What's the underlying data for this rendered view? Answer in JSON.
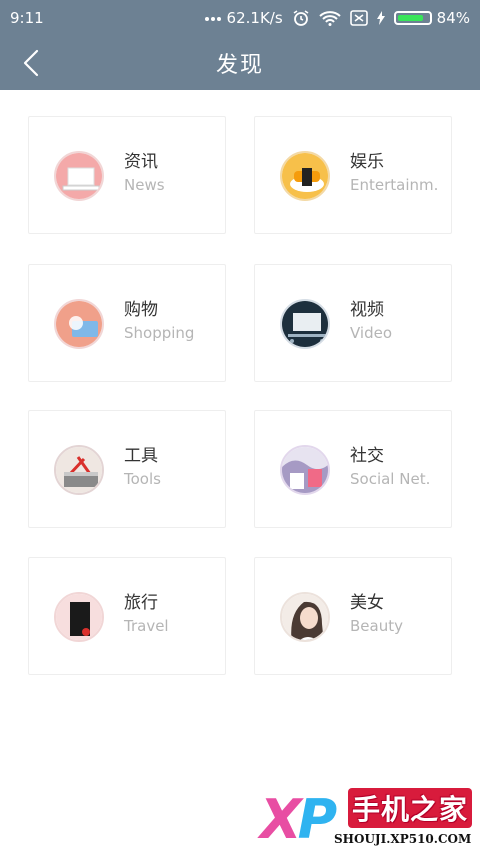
{
  "status_bar": {
    "time": "9:11",
    "net_speed": "62.1K/s",
    "battery_level": 0.84,
    "battery_text": "84%",
    "icons": [
      "signal-dots-icon",
      "alarm-icon",
      "wifi-icon",
      "sim-icon",
      "charging-icon",
      "battery-icon"
    ]
  },
  "header": {
    "back_icon": "chevron-left-icon",
    "title": "发现"
  },
  "categories": [
    {
      "cn": "资讯",
      "en": "News",
      "icon": "news-laptop-icon"
    },
    {
      "cn": "娱乐",
      "en": "Entertainm.",
      "icon": "entertainment-sushi-icon"
    },
    {
      "cn": "购物",
      "en": "Shopping",
      "icon": "shopping-card-icon"
    },
    {
      "cn": "视频",
      "en": "Video",
      "icon": "video-screen-icon"
    },
    {
      "cn": "工具",
      "en": "Tools",
      "icon": "tools-box-icon"
    },
    {
      "cn": "社交",
      "en": "Social Net.",
      "icon": "social-network-icon"
    },
    {
      "cn": "旅行",
      "en": "Travel",
      "icon": "travel-camera-icon"
    },
    {
      "cn": "美女",
      "en": "Beauty",
      "icon": "beauty-portrait-icon"
    }
  ],
  "watermark": {
    "xp_x": "X",
    "xp_p": "P",
    "cn": "手机之家",
    "url": "SHOUJI.XP510.COM"
  },
  "colors": {
    "header_bg": "#6d8193",
    "battery_green": "#39e55a"
  }
}
